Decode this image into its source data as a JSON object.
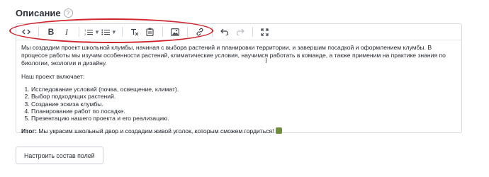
{
  "field": {
    "label": "Описание",
    "help_icon": "question-circle-icon"
  },
  "toolbar": {
    "buttons": [
      "code-view-icon",
      "bold-icon",
      "italic-icon",
      "ordered-list-icon",
      "bullet-list-icon",
      "clear-format-icon",
      "paste-icon",
      "image-icon",
      "link-icon",
      "undo-icon",
      "redo-icon",
      "fullscreen-icon"
    ],
    "bold_label": "B",
    "italic_label": "I",
    "highlight_color": "#d0222b"
  },
  "content": {
    "paragraph1": "Мы создадим проект школьной клумбы, начиная с выбора растений и планировки территории, и завершим посадкой и оформлением клумбы. В процессе работы мы изучим особенности растений, климатические условия, научимся работать в команде, а также применим на практике знания по биологии, экологии и дизайну.",
    "paragraph2": "Наш проект включает:",
    "list": [
      "Исследование условий (почва, освещение, климат).",
      "Выбор подходящих растений.",
      "Создание эскиза клумбы.",
      "Планирование работ по посадке.",
      "Презентацию нашего проекта и его реализацию."
    ],
    "result_label": "Итог:",
    "result_text": " Мы украсим школьный двор и создадим живой уголок, которым сможем гордиться!",
    "result_emoji": "seedling-emoji-icon"
  },
  "configure_button": "Настроить состав полей"
}
